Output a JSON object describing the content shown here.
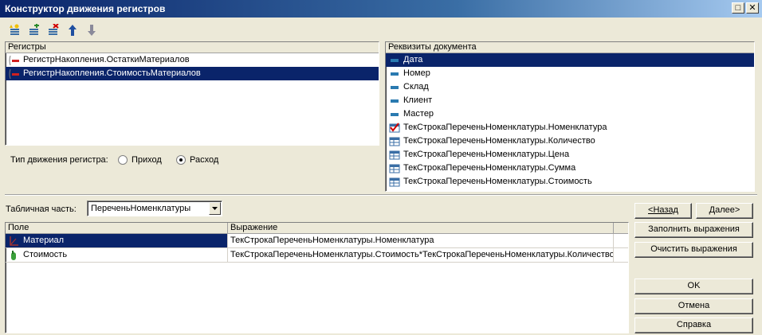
{
  "window": {
    "title": "Конструктор движения регистров"
  },
  "toolbar": {
    "icons": [
      "add-register-icon",
      "add-copy-icon",
      "delete-register-icon",
      "move-up-icon",
      "move-down-icon"
    ]
  },
  "registers": {
    "header": "Регистры",
    "items": [
      {
        "label": "РегистрНакопления.ОстаткиМатериалов",
        "selected": false
      },
      {
        "label": "РегистрНакопления.СтоимостьМатериалов",
        "selected": true
      }
    ]
  },
  "movement_type": {
    "label": "Тип движения регистра:",
    "options": [
      {
        "label": "Приход",
        "checked": false
      },
      {
        "label": "Расход",
        "checked": true
      }
    ]
  },
  "doc_attributes": {
    "header": "Реквизиты документа",
    "items": [
      {
        "label": "Дата",
        "kind": "attribute",
        "selected": true
      },
      {
        "label": "Номер",
        "kind": "attribute",
        "selected": false
      },
      {
        "label": "Склад",
        "kind": "attribute",
        "selected": false
      },
      {
        "label": "Клиент",
        "kind": "attribute",
        "selected": false
      },
      {
        "label": "Мастер",
        "kind": "attribute",
        "selected": false
      },
      {
        "label": "ТекСтрокаПереченьНоменклатуры.Номенклатура",
        "kind": "table-attr-used",
        "selected": false
      },
      {
        "label": "ТекСтрокаПереченьНоменклатуры.Количество",
        "kind": "table-attr",
        "selected": false
      },
      {
        "label": "ТекСтрокаПереченьНоменклатуры.Цена",
        "kind": "table-attr",
        "selected": false
      },
      {
        "label": "ТекСтрокаПереченьНоменклатуры.Сумма",
        "kind": "table-attr",
        "selected": false
      },
      {
        "label": "ТекСтрокаПереченьНоменклатуры.Стоимость",
        "kind": "table-attr",
        "selected": false
      }
    ]
  },
  "tabular": {
    "label": "Табличная часть:",
    "value": "ПереченьНоменклатуры"
  },
  "fields_grid": {
    "columns": [
      "Поле",
      "Выражение"
    ],
    "rows": [
      {
        "field": "Материал",
        "expression": "ТекСтрокаПереченьНоменклатуры.Номенклатура",
        "icon": "dimension-icon",
        "selected": true
      },
      {
        "field": "Стоимость",
        "expression": "ТекСтрокаПереченьНоменклатуры.Стоимость*ТекСтрокаПереченьНоменклатуры.Количество",
        "icon": "resource-icon",
        "selected": false
      }
    ]
  },
  "buttons": {
    "back": "<Назад",
    "next": "Далее>",
    "fill": "Заполнить выражения",
    "clear": "Очистить выражения",
    "ok": "OK",
    "cancel": "Отмена",
    "help": "Справка"
  },
  "colors": {
    "selection": "#0a246a",
    "face": "#ece9d8",
    "title_start": "#0a246a",
    "title_end": "#a6caf0"
  }
}
